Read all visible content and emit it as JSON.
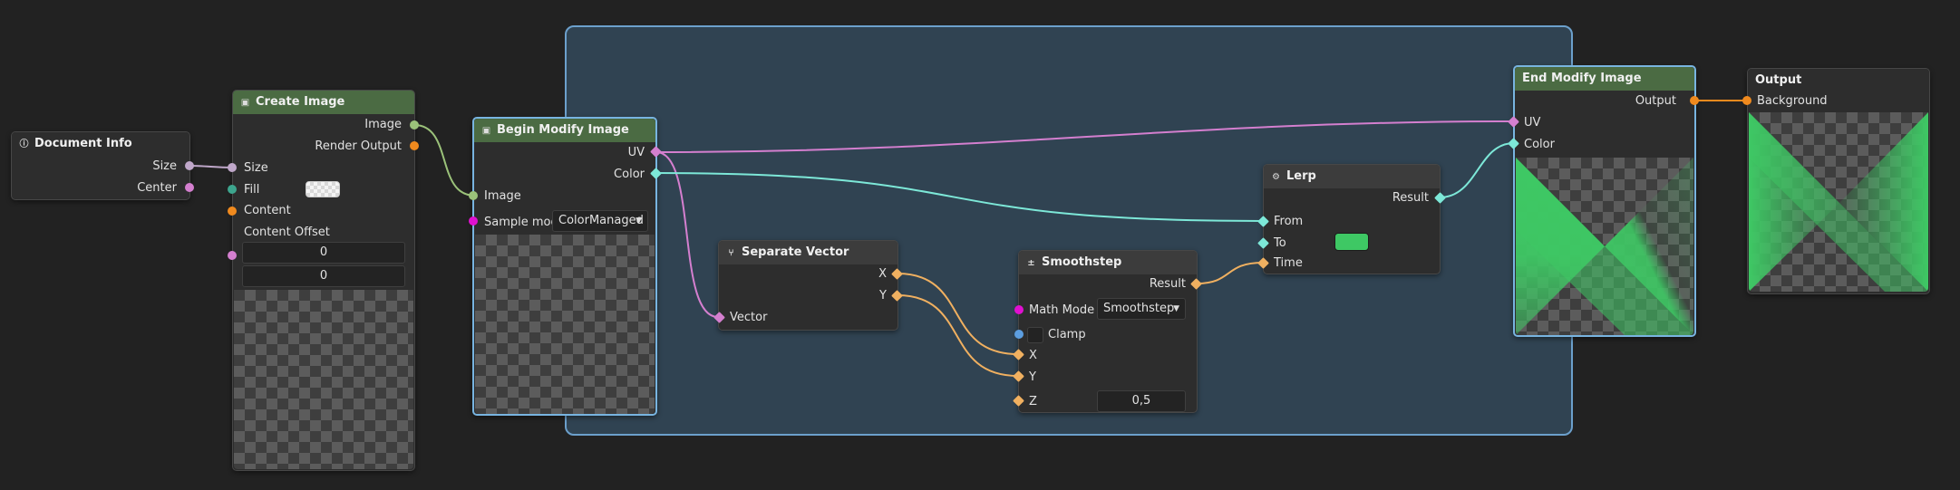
{
  "colors": {
    "background": "#222222",
    "zone_fill": "#304352",
    "zone_border": "#6ca0cc",
    "header_gray": "#3c3c3c",
    "header_green": "#4b6b43",
    "port_size": "#bfa7c9",
    "port_vector": "#d47fcf",
    "port_image": "#9bc27a",
    "port_render": "#f08a1e",
    "port_fill": "#3da58e",
    "port_enum": "#e010d0",
    "port_bool": "#5c9ee0",
    "port_number": "#f0b060",
    "port_color": "#7de8d8",
    "accent_green": "#3ec864"
  },
  "nodes": {
    "document_info": {
      "title": "Document Info",
      "icon": "info-icon",
      "outputs": {
        "size": "Size",
        "center": "Center"
      }
    },
    "create_image": {
      "title": "Create Image",
      "icon": "image-icon",
      "outputs": {
        "image": "Image",
        "render_output": "Render Output"
      },
      "inputs": {
        "size": "Size",
        "fill": "Fill",
        "content": "Content",
        "content_offset": "Content Offset"
      },
      "fill_value": "transparent",
      "offset_x": "0",
      "offset_y": "0"
    },
    "begin_modify": {
      "title": "Begin Modify Image",
      "icon": "image-icon",
      "outputs": {
        "uv": "UV",
        "color": "Color"
      },
      "inputs": {
        "image": "Image",
        "sample_mode": "Sample mode"
      },
      "sample_mode_value": "ColorManaged"
    },
    "separate_vector": {
      "title": "Separate Vector",
      "icon": "split-icon",
      "outputs": {
        "x": "X",
        "y": "Y"
      },
      "inputs": {
        "vector": "Vector"
      }
    },
    "smoothstep": {
      "title": "Smoothstep",
      "icon": "plus-minus-icon",
      "outputs": {
        "result": "Result"
      },
      "inputs": {
        "math_mode": "Math Mode",
        "clamp": "Clamp",
        "x": "X",
        "y": "Y",
        "z": "Z"
      },
      "math_mode_value": "Smoothstep",
      "z_value": "0,5"
    },
    "lerp": {
      "title": "Lerp",
      "icon": "gear-icon",
      "outputs": {
        "result": "Result"
      },
      "inputs": {
        "from": "From",
        "to": "To",
        "time": "Time"
      }
    },
    "end_modify": {
      "title": "End Modify Image",
      "outputs": {
        "output": "Output"
      },
      "inputs": {
        "uv": "UV",
        "color": "Color"
      }
    },
    "output": {
      "title": "Output",
      "inputs": {
        "background": "Background"
      }
    }
  }
}
